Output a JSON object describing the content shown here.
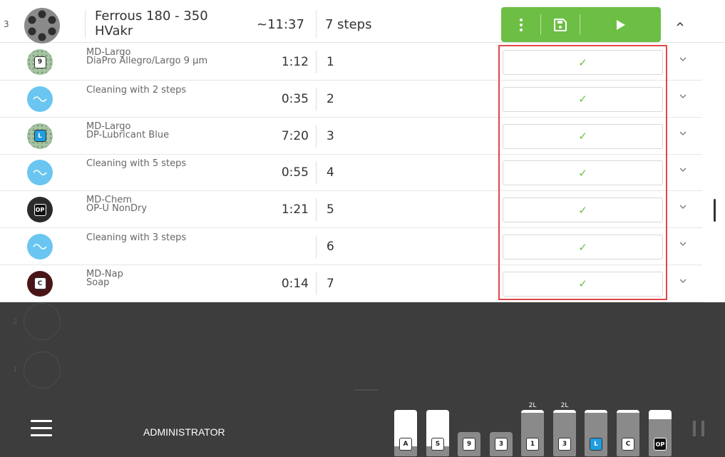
{
  "header": {
    "index": "3",
    "title_line1": "Ferrous 180 - 350",
    "title_line2": "HVakr",
    "total_time": "~11:37",
    "step_count": "7 steps"
  },
  "steps": [
    {
      "line1": "MD-Largo",
      "line2": "DiaPro Allegro/Largo 9 µm",
      "time": "1:12",
      "num": "1",
      "badge": "9",
      "disc": "green",
      "status": "✓"
    },
    {
      "line1": "Cleaning with 2 steps",
      "line2": "",
      "time": "0:35",
      "num": "2",
      "badge": "",
      "disc": "wave",
      "status": "✓"
    },
    {
      "line1": "MD-Largo",
      "line2": "DP-Lubricant Blue",
      "time": "7:20",
      "num": "3",
      "badge": "L",
      "disc": "green",
      "status": "✓"
    },
    {
      "line1": "Cleaning with 5 steps",
      "line2": "",
      "time": "0:55",
      "num": "4",
      "badge": "",
      "disc": "wave",
      "status": "✓"
    },
    {
      "line1": "MD-Chem",
      "line2": "OP-U NonDry",
      "time": "1:21",
      "num": "5",
      "badge": "OP",
      "disc": "black",
      "status": "✓"
    },
    {
      "line1": "Cleaning with 3 steps",
      "line2": "",
      "time": "",
      "num": "6",
      "badge": "",
      "disc": "wave",
      "status": "✓"
    },
    {
      "line1": "MD-Nap",
      "line2": "Soap",
      "time": "0:14",
      "num": "7",
      "badge": "C",
      "disc": "brown",
      "status": "✓"
    }
  ],
  "slots": [
    {
      "num": "2"
    },
    {
      "num": "1"
    }
  ],
  "footer": {
    "user": "ADMINISTRATOR"
  },
  "bottles": [
    {
      "label": "A",
      "cap": "",
      "level": 0.78
    },
    {
      "label": "S",
      "cap": "",
      "level": 0.78
    },
    {
      "label": "9",
      "cap": "",
      "level": 0.0
    },
    {
      "label": "3",
      "cap": "",
      "level": 0.0
    },
    {
      "label": "1",
      "cap": "2L",
      "level": 0.0
    },
    {
      "label": "3",
      "cap": "2L",
      "level": 0.0
    },
    {
      "label": "L",
      "cap": "",
      "level": 0.0
    },
    {
      "label": "C",
      "cap": "",
      "level": 0.0
    },
    {
      "label": "OP",
      "cap": "",
      "level": 0.2
    }
  ],
  "colors": {
    "accent": "#6cbf44",
    "highlight": "#e04848",
    "lubricant_blue": "#1d9ee0"
  },
  "icons": {
    "menu": "more-vertical-icon",
    "save": "save-icon",
    "run": "play-icon",
    "collapse": "chevron-up-icon",
    "expand": "chevron-down-icon",
    "done": "check-icon",
    "nav": "hamburger-icon",
    "pause": "pause-icon"
  }
}
